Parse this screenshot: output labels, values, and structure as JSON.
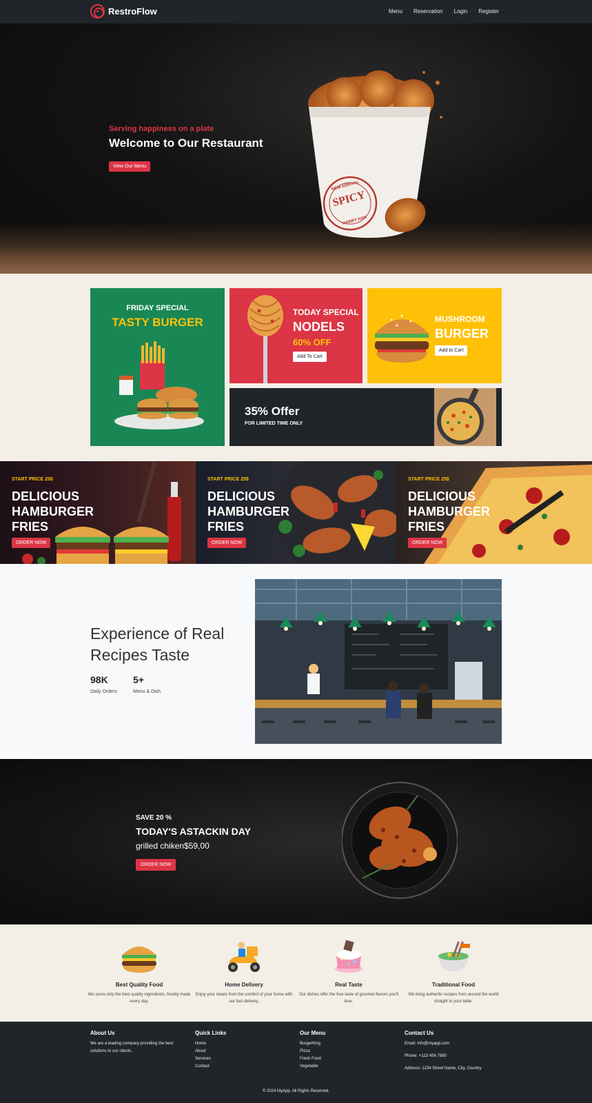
{
  "nav": {
    "brand": "RestroFlow",
    "links": [
      "Menu",
      "Reservation",
      "Login",
      "Register"
    ]
  },
  "hero": {
    "eyebrow": "Serving happiness on a plate",
    "title": "Welcome to Our Restaurant",
    "cta": "View Our Menu",
    "bucket_label": "SPICY",
    "bucket_ring_top": "NEW ARRIVAL",
    "bucket_ring_bottom": "HABBY HAN"
  },
  "specials": {
    "friday": {
      "kicker": "FRIDAY SPECIAL",
      "title": "TASTY BURGER"
    },
    "today": {
      "kicker": "TODAY SPECIAL",
      "title": "NODELS",
      "discount": "60% OFF",
      "button": "Add To Cart"
    },
    "mushroom": {
      "kicker": "MUSHROOM",
      "title": "BURGER",
      "button": "Add to Cart"
    },
    "offer": {
      "title": "35% Offer",
      "subtitle": "FOR LIMITED TIME ONLY"
    }
  },
  "promos": [
    {
      "price": "START PRICE 25$",
      "title": "DELICIOUS HAMBURGER FRIES",
      "button": "ORDER NOW"
    },
    {
      "price": "START PRICE 25$",
      "title": "DELICIOUS HAMBURGER FRIES",
      "button": "ORDER NOW"
    },
    {
      "price": "START PRICE 25$",
      "title": "DELICIOUS HAMBURGER FRIES",
      "button": "ORDER NOW"
    }
  ],
  "experience": {
    "title": "Experience of Real Recipes Taste",
    "stats": [
      {
        "value": "98K",
        "label": "Daily Orders"
      },
      {
        "value": "5+",
        "label": "Menu & Dish"
      }
    ]
  },
  "deal": {
    "save": "SAVE 20 %",
    "day": "TODAY'S ASTACKIN DAY",
    "price": "grilled chiken$59,00",
    "button": "ORDER NOW"
  },
  "features": [
    {
      "icon": "burger-icon",
      "title": "Best Quality Food",
      "desc": "We serve only the best quality ingredients, freshly made every day."
    },
    {
      "icon": "delivery-scooter-icon",
      "title": "Home Delivery",
      "desc": "Enjoy your meals from the comfort of your home with our fast delivery."
    },
    {
      "icon": "cake-icon",
      "title": "Real Taste",
      "desc": "Our dishes offer the true taste of gourmet flavors you'll love."
    },
    {
      "icon": "noodle-bowl-icon",
      "title": "Traditional Food",
      "desc": "We bring authentic recipes from around the world straight to your table."
    }
  ],
  "footer": {
    "about": {
      "heading": "About Us",
      "text": "We are a leading company providing the best solutions to our clients."
    },
    "quick": {
      "heading": "Quick Links",
      "items": [
        "Home",
        "About",
        "Services",
        "Contact"
      ]
    },
    "menu": {
      "heading": "Our Menu",
      "items": [
        "BurgerKing",
        "Pizza",
        "Fresh Food",
        "Vegetable"
      ]
    },
    "contact": {
      "heading": "Contact Us",
      "email": "Email: info@myapp.com",
      "phone": "Phone: +123 456 7890",
      "address": "Address: 1234 Street Name, City, Country"
    },
    "copyright": "© 2024 MyApp. All Rights Reserved."
  },
  "colors": {
    "accent": "#dc3545",
    "dark": "#212529",
    "yellow": "#ffc107",
    "green": "#198754",
    "cream": "#f3efe6"
  }
}
